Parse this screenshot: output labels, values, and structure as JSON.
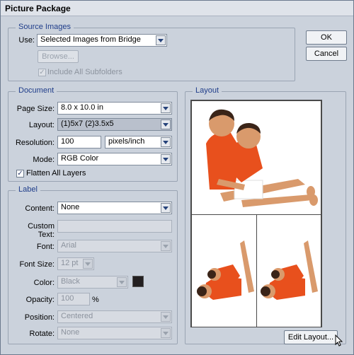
{
  "window": {
    "title": "Picture Package"
  },
  "buttons": {
    "ok": "OK",
    "cancel": "Cancel",
    "edit_layout": "Edit Layout..."
  },
  "source": {
    "legend": "Source Images",
    "use_label": "Use:",
    "use_value": "Selected Images from Bridge",
    "browse": "Browse...",
    "include_subfolders": "Include All Subfolders"
  },
  "document": {
    "legend": "Document",
    "page_size_label": "Page Size:",
    "page_size_value": "8.0 x 10.0 in",
    "layout_label": "Layout:",
    "layout_value": "(1)5x7 (2)3.5x5",
    "resolution_label": "Resolution:",
    "resolution_value": "100",
    "resolution_unit": "pixels/inch",
    "mode_label": "Mode:",
    "mode_value": "RGB Color",
    "flatten_label": "Flatten All Layers"
  },
  "label": {
    "legend": "Label",
    "content_label": "Content:",
    "content_value": "None",
    "custom_text_label": "Custom Text:",
    "custom_text_value": "",
    "font_label": "Font:",
    "font_value": "Arial",
    "font_size_label": "Font Size:",
    "font_size_value": "12 pt",
    "color_label": "Color:",
    "color_value": "Black",
    "opacity_label": "Opacity:",
    "opacity_value": "100",
    "opacity_unit": "%",
    "position_label": "Position:",
    "position_value": "Centered",
    "rotate_label": "Rotate:",
    "rotate_value": "None"
  },
  "layout_panel": {
    "legend": "Layout"
  },
  "colors": {
    "swatch": "#231f20",
    "shirt": "#e8501d",
    "skin": "#d99a6c",
    "hair": "#3a2418"
  }
}
